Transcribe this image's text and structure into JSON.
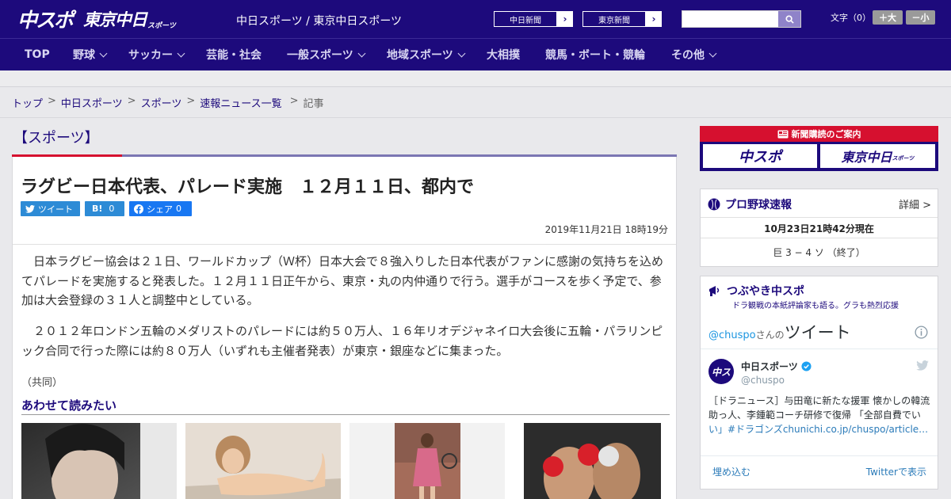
{
  "header": {
    "logo_main": "中スポ",
    "logo_tokyo": "東京中日",
    "logo_tokyo_sub": "スポーツ",
    "site_name": "中日スポーツ / 東京中日スポーツ",
    "ext_links": [
      {
        "label": "中日新聞"
      },
      {
        "label": "東京新聞"
      }
    ],
    "search_placeholder": "",
    "font_size_label": "文字（0）",
    "font_plus": "＋大",
    "font_minus": "－小"
  },
  "nav": [
    {
      "label": "TOP",
      "dropdown": false
    },
    {
      "label": "野球",
      "dropdown": true
    },
    {
      "label": "サッカー",
      "dropdown": true
    },
    {
      "label": "芸能・社会",
      "dropdown": false
    },
    {
      "label": "一般スポーツ",
      "dropdown": true
    },
    {
      "label": "地域スポーツ",
      "dropdown": true
    },
    {
      "label": "大相撲",
      "dropdown": false
    },
    {
      "label": "競馬・ボート・競輪",
      "dropdown": false
    },
    {
      "label": "その他",
      "dropdown": true
    }
  ],
  "breadcrumb": [
    "トップ",
    "中日スポーツ",
    "スポーツ",
    "速報ニュース一覧",
    "記事"
  ],
  "article": {
    "category": "【スポーツ】",
    "headline": "ラグビー日本代表、パレード実施　１２月１１日、都内で",
    "share": {
      "tweet": "ツイート",
      "hatena": "B!",
      "hatena_count": "0",
      "facebook": "シェア",
      "facebook_count": "0"
    },
    "date": "2019年11月21日 18時19分",
    "paragraphs": [
      "日本ラグビー協会は２１日、ワールドカップ（Ｗ杯）日本大会で８強入りした日本代表がファンに感謝の気持ちを込めてパレードを実施すると発表した。１２月１１日正午から、東京・丸の内仲通りで行う。選手がコースを歩く予定で、参加は大会登録の３１人と調整中としている。",
      "２０１２年ロンドン五輪のメダリストのパレードには約５０万人、１６年リオデジャネイロ大会後に五輪・パラリンピック合同で行った際には約８０万人（いずれも主催者発表）が東京・銀座などに集まった。"
    ],
    "credit": "（共同）",
    "related_heading": "あわせて読みたい"
  },
  "sidebar": {
    "subscribe": {
      "heading": "新聞購読のご案内",
      "btn1": "中スポ",
      "btn2": "東京中日",
      "btn2_sub": "スポーツ"
    },
    "baseball": {
      "title": "プロ野球速報",
      "more": "詳細 >",
      "timestamp": "10月23日21時42分現在",
      "score": "巨 3 − 4 ソ （終了）"
    },
    "twitter": {
      "title": "つぶやき中スポ",
      "subtitle": "ドラ観戦の本紙評論家も語る。グラも熱烈応援",
      "handle_prefix": "@chuspo",
      "handle_mid": "さんの",
      "handle_suffix": "ツイート",
      "user_name": "中日スポーツ",
      "user_handle": "@chuspo",
      "tweet_text": "［ドラニュース］与田竜に新たな援軍 懐かしの韓流助っ人、李鍾範コーチ研修で復帰 「全部自費でい",
      "tweet_text_end": "い」#ドラゴンズchunichi.co.jp/chuspo/article…",
      "embed": "埋め込む",
      "view_on": "Twitterで表示"
    }
  },
  "colors": {
    "brand": "#1d0a7c",
    "accent_red": "#d6102f",
    "link_blue": "#2d8bd6"
  }
}
